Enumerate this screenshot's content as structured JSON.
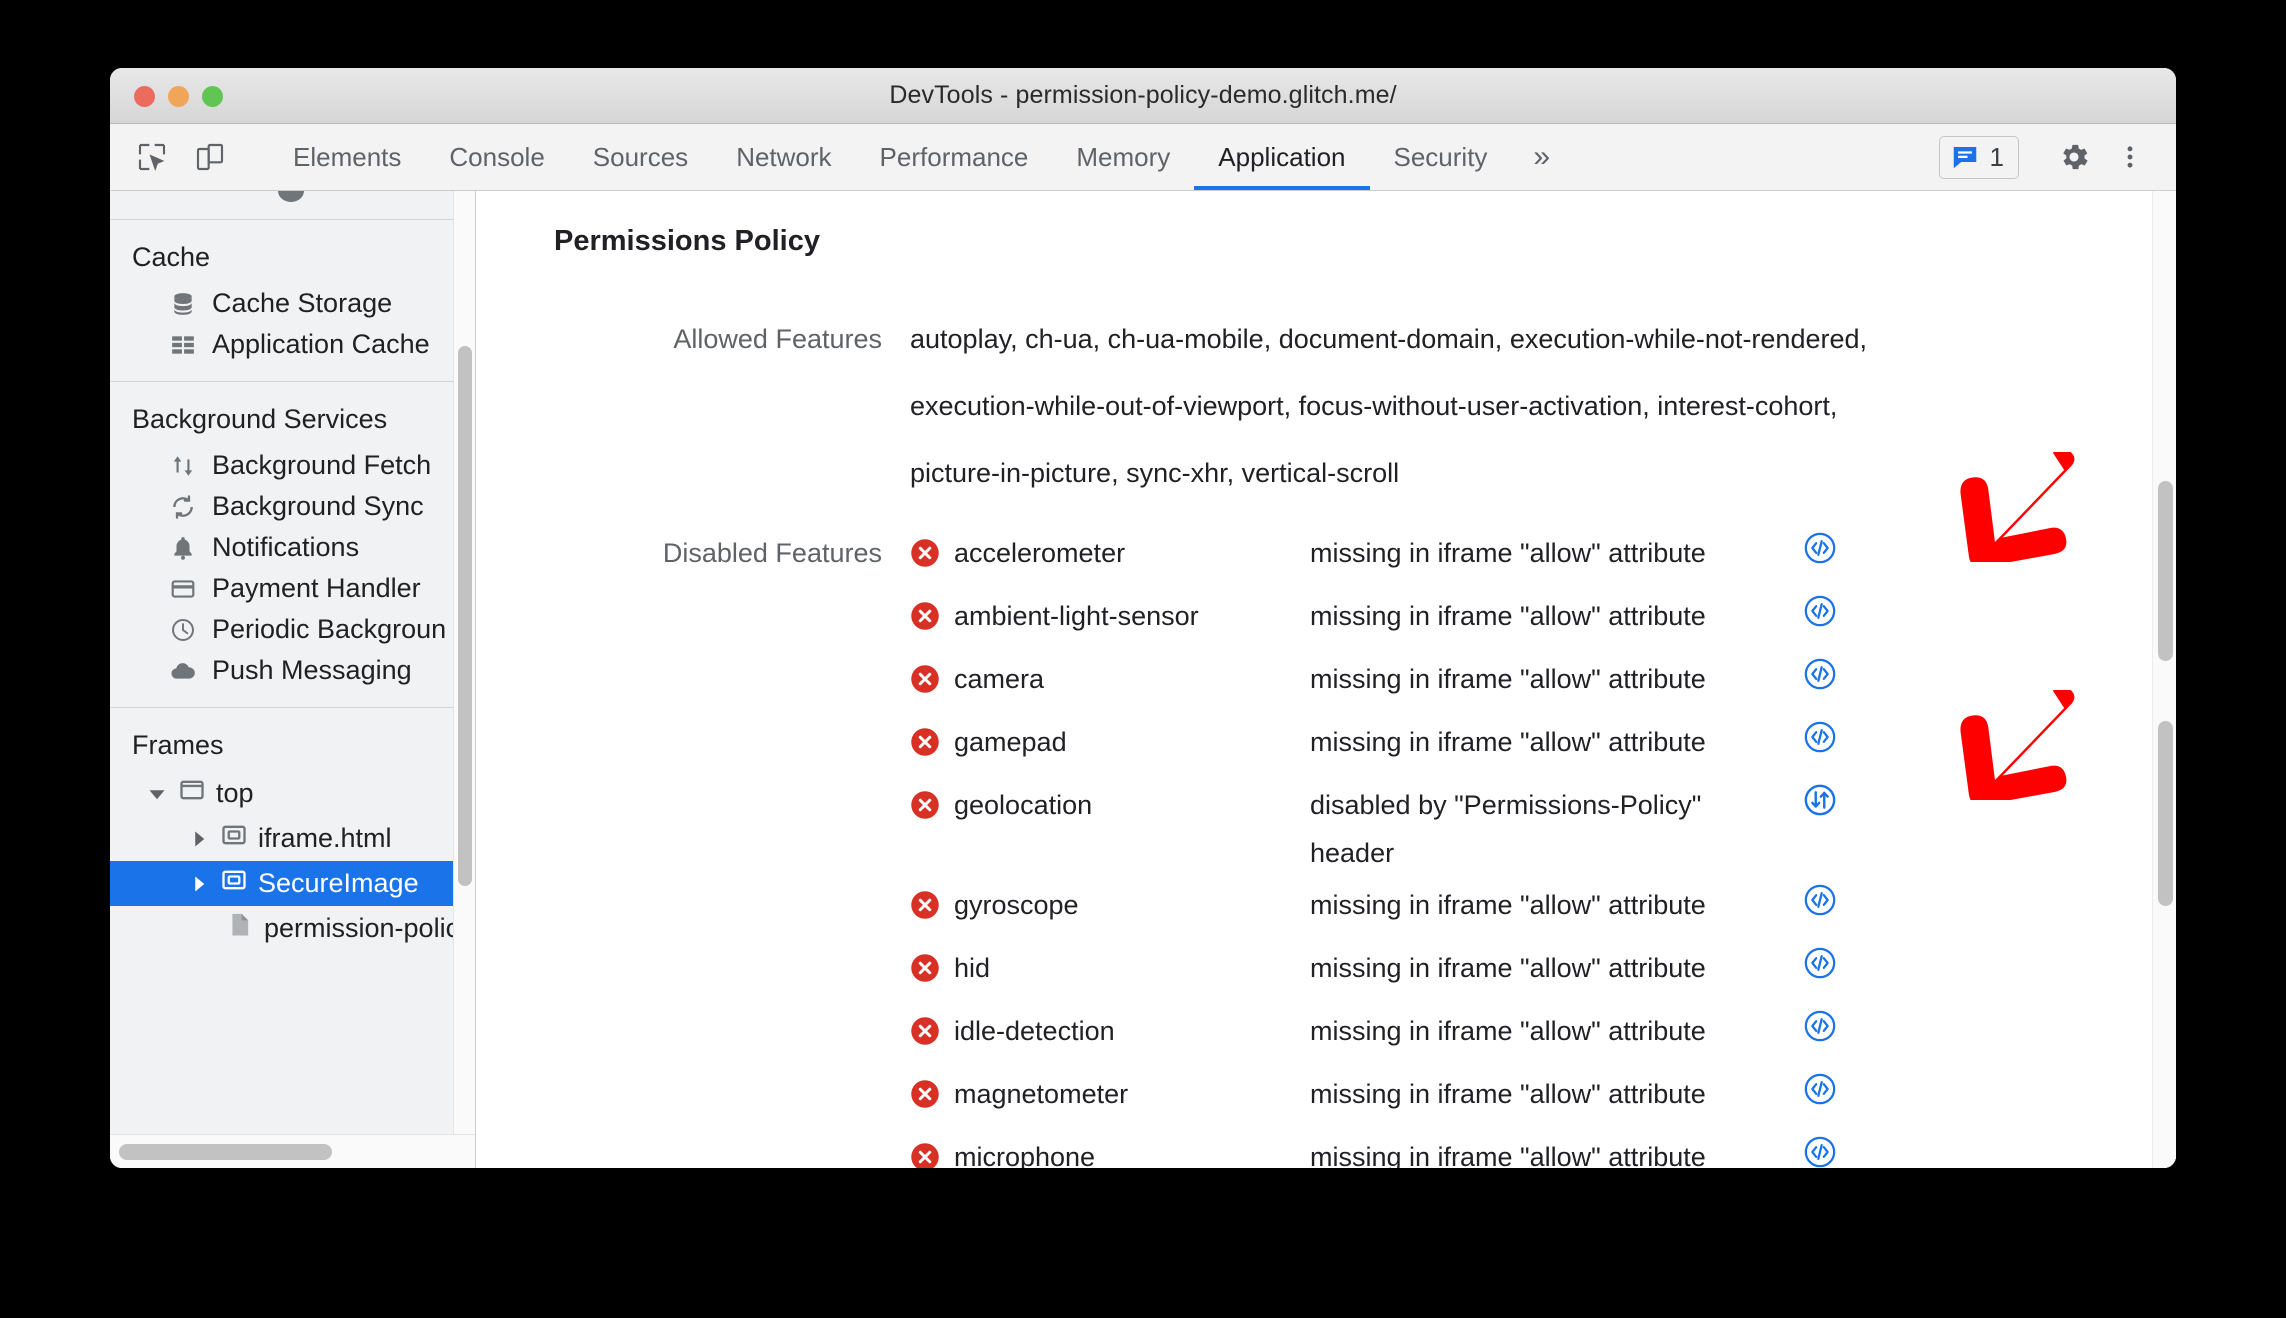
{
  "window": {
    "title": "DevTools - permission-policy-demo.glitch.me/",
    "controls": [
      "close",
      "minimize",
      "maximize"
    ]
  },
  "toolbar": {
    "inspect_icon": "inspect-element-icon",
    "device_icon": "device-toolbar-icon",
    "tabs": [
      {
        "label": "Elements",
        "selected": false
      },
      {
        "label": "Console",
        "selected": false
      },
      {
        "label": "Sources",
        "selected": false
      },
      {
        "label": "Network",
        "selected": false
      },
      {
        "label": "Performance",
        "selected": false
      },
      {
        "label": "Memory",
        "selected": false
      },
      {
        "label": "Application",
        "selected": true
      },
      {
        "label": "Security",
        "selected": false
      }
    ],
    "overflow_label": "»",
    "message_count": "1",
    "settings_icon": "gear-icon",
    "more_icon": "more-vertical-icon",
    "accent_color": "#1a73e8"
  },
  "sidebar": {
    "groups": [
      {
        "title": "Cache",
        "items": [
          {
            "label": "Cache Storage",
            "icon": "database-icon"
          },
          {
            "label": "Application Cache",
            "icon": "grid-icon"
          }
        ]
      },
      {
        "title": "Background Services",
        "items": [
          {
            "label": "Background Fetch",
            "icon": "up-down-arrows-icon"
          },
          {
            "label": "Background Sync",
            "icon": "sync-icon"
          },
          {
            "label": "Notifications",
            "icon": "bell-icon"
          },
          {
            "label": "Payment Handler",
            "icon": "credit-card-icon"
          },
          {
            "label": "Periodic Backgroun",
            "icon": "clock-icon"
          },
          {
            "label": "Push Messaging",
            "icon": "cloud-icon"
          }
        ]
      }
    ],
    "frames": {
      "title": "Frames",
      "tree": [
        {
          "label": "top",
          "icon": "frame-icon",
          "depth": 1,
          "caret": "down",
          "selected": false
        },
        {
          "label": "iframe.html",
          "icon": "nested-frame-icon",
          "depth": 2,
          "caret": "right",
          "selected": false
        },
        {
          "label": "SecureImage",
          "icon": "nested-frame-icon",
          "depth": 2,
          "caret": "right",
          "selected": true
        },
        {
          "label": "permission-policy",
          "icon": "document-icon",
          "depth": 3,
          "caret": "none",
          "selected": false
        }
      ]
    },
    "selection_color": "#1a73e8"
  },
  "main": {
    "panel_title": "Permissions Policy",
    "allowed": {
      "label": "Allowed Features",
      "lines": [
        "autoplay, ch-ua, ch-ua-mobile, document-domain, execution-while-not-rendered,",
        "execution-while-out-of-viewport, focus-without-user-activation, interest-cohort,",
        "picture-in-picture, sync-xhr, vertical-scroll"
      ]
    },
    "disabled": {
      "label": "Disabled Features",
      "rows": [
        {
          "name": "accelerometer",
          "reason": "missing in iframe \"allow\" attribute",
          "reason2": "",
          "link_icon": "code-brackets-icon"
        },
        {
          "name": "ambient-light-sensor",
          "reason": "missing in iframe \"allow\" attribute",
          "reason2": "",
          "link_icon": "code-brackets-icon"
        },
        {
          "name": "camera",
          "reason": "missing in iframe \"allow\" attribute",
          "reason2": "",
          "link_icon": "code-brackets-icon"
        },
        {
          "name": "gamepad",
          "reason": "missing in iframe \"allow\" attribute",
          "reason2": "",
          "link_icon": "code-brackets-icon"
        },
        {
          "name": "geolocation",
          "reason": "disabled by \"Permissions-Policy\"",
          "reason2": "header",
          "link_icon": "network-request-icon"
        },
        {
          "name": "gyroscope",
          "reason": "missing in iframe \"allow\" attribute",
          "reason2": "",
          "link_icon": "code-brackets-icon"
        },
        {
          "name": "hid",
          "reason": "missing in iframe \"allow\" attribute",
          "reason2": "",
          "link_icon": "code-brackets-icon"
        },
        {
          "name": "idle-detection",
          "reason": "missing in iframe \"allow\" attribute",
          "reason2": "",
          "link_icon": "code-brackets-icon"
        },
        {
          "name": "magnetometer",
          "reason": "missing in iframe \"allow\" attribute",
          "reason2": "",
          "link_icon": "code-brackets-icon"
        },
        {
          "name": "microphone",
          "reason": "missing in iframe \"allow\" attribute",
          "reason2": "",
          "link_icon": "code-brackets-icon"
        }
      ],
      "error_icon": "error-circle-x-icon",
      "error_color": "#d93025",
      "link_color": "#1a73e8"
    }
  },
  "annotations": {
    "arrows": [
      {
        "name": "arrow-to-accelerometer-link",
        "color": "#ff0000"
      },
      {
        "name": "arrow-to-geolocation-link",
        "color": "#ff0000"
      }
    ]
  }
}
